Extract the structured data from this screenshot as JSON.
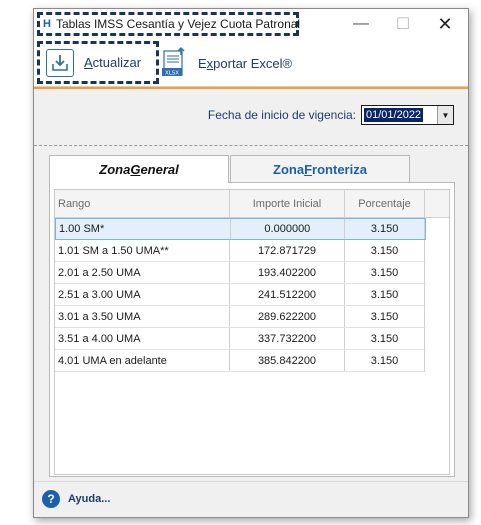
{
  "window": {
    "title": "Tablas IMSS Cesantía y Vejez Cuota Patronal",
    "app_icon": "H",
    "minimize_glyph": "—",
    "maximize_glyph": "☐",
    "close_glyph": "✕"
  },
  "toolbar": {
    "update_label_u": "A",
    "update_label_rest": "ctualizar",
    "export_label_pre": "E",
    "export_label_u": "x",
    "export_label_rest": "portar Excel®",
    "xlsx_badge": "XLSX"
  },
  "filter": {
    "date_label": "Fecha de inicio de vigencia:",
    "date_value": "01/01/2022",
    "date_arrow": "▼"
  },
  "tabs": [
    {
      "label_pre": "Zona ",
      "label_u": "G",
      "label_rest": "eneral",
      "active": true
    },
    {
      "label_pre": "Zona ",
      "label_u": "F",
      "label_rest": "ronteriza",
      "active": false
    }
  ],
  "grid": {
    "headers": [
      "Rango",
      "Importe Inicial",
      "Porcentaje"
    ],
    "rows": [
      {
        "rango": "1.00 SM*",
        "importe": "0.000000",
        "porcentaje": "3.150"
      },
      {
        "rango": "1.01 SM a 1.50 UMA**",
        "importe": "172.871729",
        "porcentaje": "3.150"
      },
      {
        "rango": "2.01 a 2.50 UMA",
        "importe": "193.402200",
        "porcentaje": "3.150"
      },
      {
        "rango": "2.51 a 3.00 UMA",
        "importe": "241.512200",
        "porcentaje": "3.150"
      },
      {
        "rango": "3.01 a 3.50 UMA",
        "importe": "289.622200",
        "porcentaje": "3.150"
      },
      {
        "rango": "3.51 a 4.00 UMA",
        "importe": "337.732200",
        "porcentaje": "3.150"
      },
      {
        "rango": "4.01 UMA en adelante",
        "importe": "385.842200",
        "porcentaje": "3.150"
      }
    ]
  },
  "status": {
    "help_glyph": "?",
    "help_label": "Ayuda..."
  },
  "colors": {
    "accent_blue": "#1a5fb0",
    "highlight_dashed": "#15355c",
    "orange_line": "#f0a030",
    "selected_row": "#e3f0fb"
  }
}
